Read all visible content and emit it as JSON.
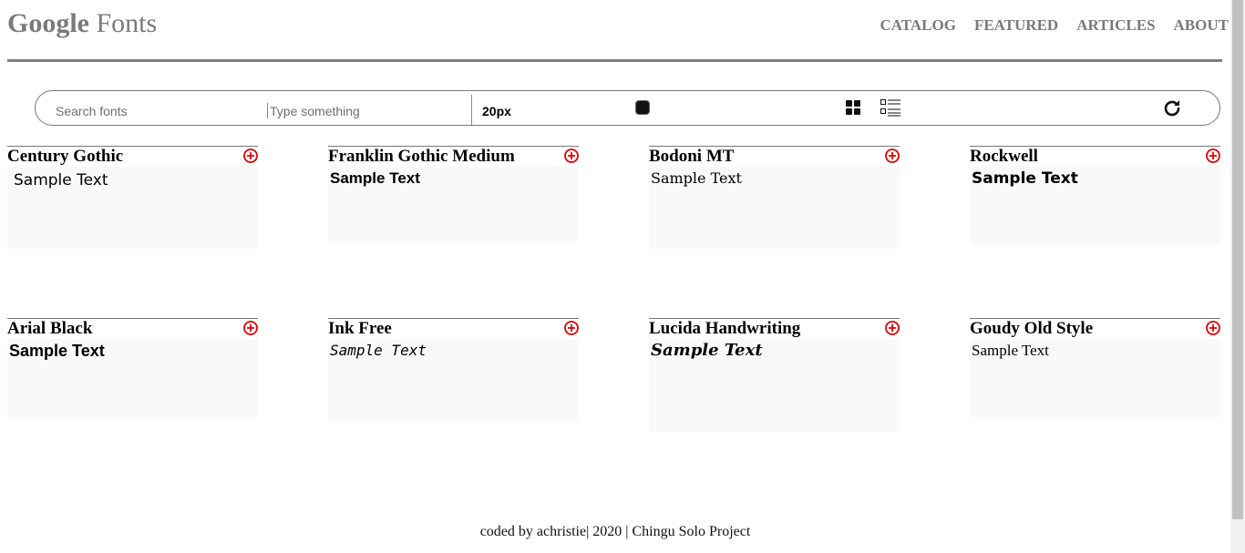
{
  "header": {
    "logo_bold": "Google",
    "logo_rest": " Fonts",
    "nav": [
      "CATALOG",
      "FEATURED",
      "ARTICLES",
      "ABOUT"
    ]
  },
  "toolbar": {
    "search_placeholder": "Search fonts",
    "type_placeholder": "Type something",
    "font_size": "20px"
  },
  "cards": [
    {
      "name": "Century Gothic",
      "sample": "Sample Text"
    },
    {
      "name": "Franklin Gothic Medium",
      "sample": "Sample Text"
    },
    {
      "name": "Bodoni MT",
      "sample": "Sample Text"
    },
    {
      "name": "Rockwell",
      "sample": "Sample Text"
    },
    {
      "name": "Arial Black",
      "sample": "Sample Text"
    },
    {
      "name": "Ink Free",
      "sample": "Sample Text"
    },
    {
      "name": "Lucida Handwriting",
      "sample": "Sample Text"
    },
    {
      "name": "Goudy Old Style",
      "sample": "Sample Text"
    }
  ],
  "footer": "coded by achristie| 2020 | Chingu Solo Project",
  "colors": {
    "accent_add": "#e00000",
    "nav": "#7a7a7a"
  }
}
